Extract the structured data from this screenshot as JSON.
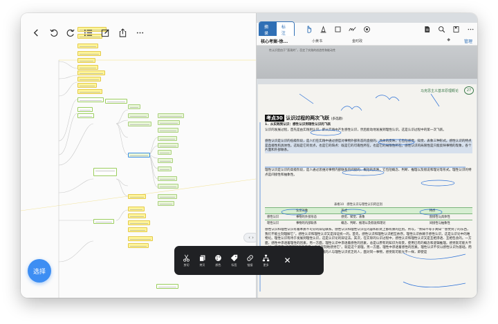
{
  "left_toolbar": {
    "icons": [
      "back-icon",
      "undo-icon",
      "redo-icon",
      "outline-icon",
      "edit-icon",
      "share-icon",
      "more-icon"
    ]
  },
  "select_button": {
    "label": "选择"
  },
  "floating_toolbar": {
    "items": [
      {
        "icon": "scissors-icon",
        "label": "剪切"
      },
      {
        "icon": "copy-icon",
        "label": "拷贝"
      },
      {
        "icon": "palette-icon",
        "label": "颜色"
      },
      {
        "icon": "tag-icon",
        "label": "标签"
      },
      {
        "icon": "link-icon",
        "label": "链接"
      },
      {
        "icon": "hierarchy-icon",
        "label": "更多"
      }
    ],
    "close_icon": "✕"
  },
  "split_handle": {
    "label": "‹ ›"
  },
  "pdf_toolbar": {
    "tabs": [
      {
        "label": "摘录",
        "active": true
      },
      {
        "label": "标注",
        "active": false
      }
    ],
    "tool_icons": [
      "hand-icon",
      "pen-icon",
      "rect-select-icon",
      "signature-icon",
      "stamp-icon"
    ],
    "right_icons": [
      "document-icon",
      "search-icon",
      "bookmark-icon",
      "more-icon"
    ]
  },
  "document": {
    "title": "核心考案-徐...",
    "sub1": "小黄书",
    "sub2": "金时政",
    "manage": "管理",
    "top_fragment": "性认识是由于“直观的”，否定了实践的创造性和能动性",
    "page_header": "马克思主义基本原理概论",
    "page_number": "27",
    "kp_badge": "考点30",
    "kp_title": "认识过程的两次飞跃",
    "kp_level": "(多选题)",
    "lines": [
      "1．从实践到认识：感性认识到理性认识的飞跃",
      "认识的发展过程，首先是由实践到认识，即从实践中产生感性认识，然后能动地发展到理性认识。这是认识过程中的第一次飞跃。",
      "感性认识是认识的低级阶段，是人们在实践中通过感官对事物外部形态的直接的、具体的反映，它包括感觉、知觉、表象三种形式。感性认识的特点是直接性和具体性。这既是它的优点，也是它的缺点：既是它的可靠性所在，也是它的局限性所在。感性认识的局限性是只能反映事物的现象，各个片面和外部联系。",
      "理性认识是认识的高级阶段，是人通过思维对事物内部联系的间接的、概括的反映，它包括概念、判断、推理以及假说和理论等形式。理性认识的特点是间接性和抽象性。"
    ],
    "table_caption": "表格10　感性认识与理性认识的区别",
    "table": {
      "headers": [
        "",
        "认识对象",
        "形式",
        "特点"
      ],
      "rows": [
        [
          "感性认识",
          "事物的外部形态",
          "感觉、知觉、表象",
          "直接性与具体性"
        ],
        [
          "理性认识",
          "事物的内部联系",
          "概念、判断、推理以及假说和理论",
          "间接性与抽象性"
        ]
      ]
    },
    "lines2": [
      "感性认识和理性认识有着本质不可分的辩证联系。感性认识和理性认识在内容和形式上都有质的区别。所以，“熟知不等于真知”“感觉到了的东西，我们不能立刻理解它”。感性认识和理性认识又是辩证统一的。首先，感性认识和理性认识相互依存。理性认识依赖于感性认识，这是认识论中的唯物论。理性认识有待于发展到理性认识，这是认识论的辩证法。其次，在实际的认识过程中，感性认识和理性认识又是互相渗透、互相包含的。一方面，感性中渗透着理性的因素，另一方面，理性认识中渗透着感性的因素，总是以原有的知识为背景，使用已有的概念和逻辑推理。感觉就可能大不一样，即使是“只有理解了的东西才能更深刻地感觉它”。就是这个道理。另一方面，理性中渗透着感性的因素。理性认识不仅以感性认识为基础，而且要通过感性的认识来说明。理性认识丰富的人与理性认识贫乏的人，面对同一事物，感觉就可能大不一样，即使是"
    ]
  }
}
